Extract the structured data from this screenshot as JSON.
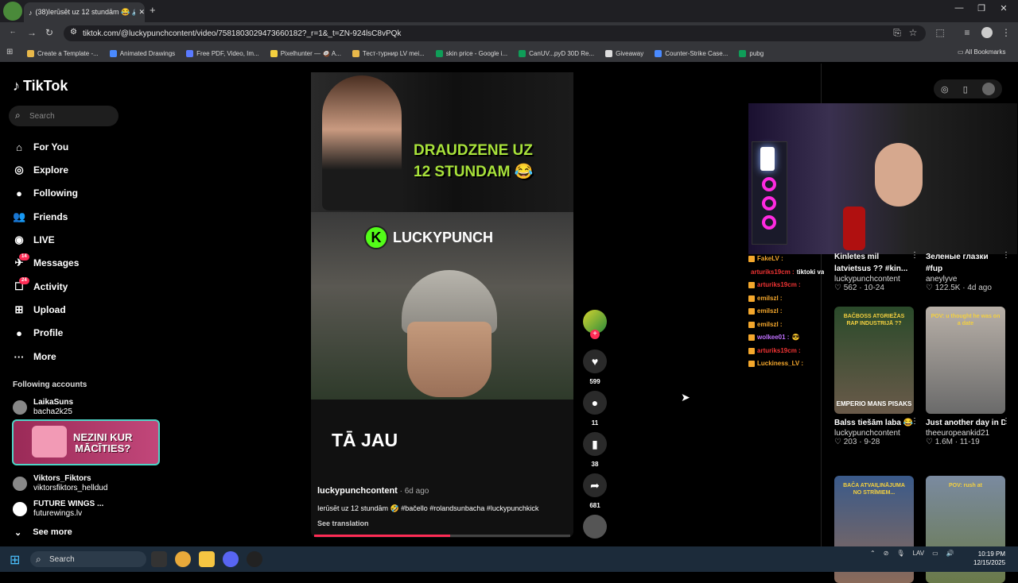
{
  "browser": {
    "tab_title": "(38)Ierūsēt uz 12 stundām 😂 🔊",
    "url": "tiktok.com/@luckypunchcontent/video/7581803029473660182?_r=1&_t=ZN-924lsC8vPQk",
    "bookmarks": [
      {
        "label": "Create a Template -...",
        "color": "#e8b84a"
      },
      {
        "label": "Animated Drawings",
        "color": "#4a8aff"
      },
      {
        "label": "Free PDF, Video, Im...",
        "color": "#5a7aff"
      },
      {
        "label": "Pixelhunter — 🥥 A...",
        "color": "#f4d03f"
      },
      {
        "label": "Тест-турнир LV mei...",
        "color": "#e8b84a"
      },
      {
        "label": "skin price - Google i...",
        "color": "#0f9d58"
      },
      {
        "label": "CanUV...pyD 30D Re...",
        "color": "#0f9d58"
      },
      {
        "label": "Giveaway",
        "color": "#dddddd"
      },
      {
        "label": "Counter-Strike Case...",
        "color": "#4a8aff"
      },
      {
        "label": "pubg",
        "color": "#0f9d58"
      }
    ],
    "all_bookmarks": "All Bookmarks"
  },
  "sidebar": {
    "logo": "TikTok",
    "search_placeholder": "Search",
    "nav": [
      {
        "label": "For You",
        "icon": "home-icon",
        "glyph": "⌂"
      },
      {
        "label": "Explore",
        "icon": "compass-icon",
        "glyph": "◎"
      },
      {
        "label": "Following",
        "icon": "following-avatar-icon",
        "glyph": "●"
      },
      {
        "label": "Friends",
        "icon": "friends-icon",
        "glyph": "👥"
      },
      {
        "label": "LIVE",
        "icon": "live-icon",
        "glyph": "◉"
      },
      {
        "label": "Messages",
        "icon": "messages-icon",
        "glyph": "✈",
        "badge": "14"
      },
      {
        "label": "Activity",
        "icon": "activity-icon",
        "glyph": "☐",
        "badge": "24"
      },
      {
        "label": "Upload",
        "icon": "upload-icon",
        "glyph": "⊞"
      },
      {
        "label": "Profile",
        "icon": "profile-avatar-icon",
        "glyph": "●"
      },
      {
        "label": "More",
        "icon": "more-icon",
        "glyph": "···"
      }
    ],
    "following_heading": "Following accounts",
    "accounts": [
      {
        "name": "LaikaSuns",
        "handle": "bacha2k25"
      },
      {
        "name": "Viktors_Fiktors",
        "handle": "viktorsfiktors_helldud"
      },
      {
        "name": "FUTURE WINGS ...",
        "handle": "futurewings.lv"
      }
    ],
    "ad_text": "NEZINI KUR\nMĀCĪTIES?",
    "see_more": "See more"
  },
  "video": {
    "headline_line1": "DRAUDZENE UZ",
    "headline_line2": "12 STUNDAM 😂",
    "brand": "LUCKYPUNCH",
    "overlay_text": "TĀ JAU",
    "author": "luckypunchcontent",
    "age": " · 6d ago",
    "caption": "Ierūsēt uz 12 stundām 🤣 #bačello #rolandsunbacha #luckypunchkick",
    "see_translation": "See translation",
    "progress": 0.53
  },
  "actions": {
    "likes": "599",
    "comments": "11",
    "saves": "38",
    "shares": "681"
  },
  "chat": [
    {
      "user": "FakeLV :",
      "msg": "",
      "cls": "cu"
    },
    {
      "user": "arturiks19cm :",
      "msg": "tiktoki vairs nestrādā",
      "cls": "cr"
    },
    {
      "user": "arturiks19cm :",
      "msg": "",
      "cls": "cr"
    },
    {
      "user": "emilszl :",
      "msg": "",
      "cls": "cu"
    },
    {
      "user": "emilszl :",
      "msg": "",
      "cls": "cu"
    },
    {
      "user": "emilszl :",
      "msg": "",
      "cls": "cu"
    },
    {
      "user": "wolkee01 :",
      "msg": "😎",
      "cls": "cv"
    },
    {
      "user": "arturiks19cm :",
      "msg": "",
      "cls": "cr"
    },
    {
      "user": "Luckiness_LV :",
      "msg": "",
      "cls": "cu"
    }
  ],
  "related": [
    {
      "title": "Kinletes mil latvietsus ?? #kin...",
      "author": "luckypunchcontent",
      "stats": "♡ 562 · 10-24"
    },
    {
      "title": "Зеленые глазки #fup",
      "author": "aneylyve",
      "stats": "♡ 122.5K · 4d ago"
    },
    {
      "title": "Balss tiešām laba 😂👌 #bachello...",
      "author": "luckypunchcontent",
      "stats": "♡ 203 · 9-28",
      "thumb_text": "EMPERIO  MANS PISAKS",
      "thumb_top": "BAČBOSS ATGRIEŽAS RAP INDUSTRIJĀ ??"
    },
    {
      "title": "Just another day in Dubai....",
      "author": "theeuropeankid21",
      "stats": "♡ 1.6M · 11-19",
      "thumb_top": "POV: u thought he was on a date"
    },
    {
      "title": "",
      "author": "",
      "stats": "",
      "thumb_top": "BAČA ATVAIĻINĀJUMA NO STRĪMIEM..."
    },
    {
      "title": "",
      "author": "",
      "stats": "",
      "thumb_top": "POV: rush at"
    }
  ],
  "taskbar": {
    "search": "Search",
    "lang": "LAV",
    "time": "10:19 PM",
    "date": "12/15/2025"
  },
  "colors": {
    "accent": "#fe2c55",
    "headline": "#a8e23a",
    "kick": "#53fc18"
  }
}
